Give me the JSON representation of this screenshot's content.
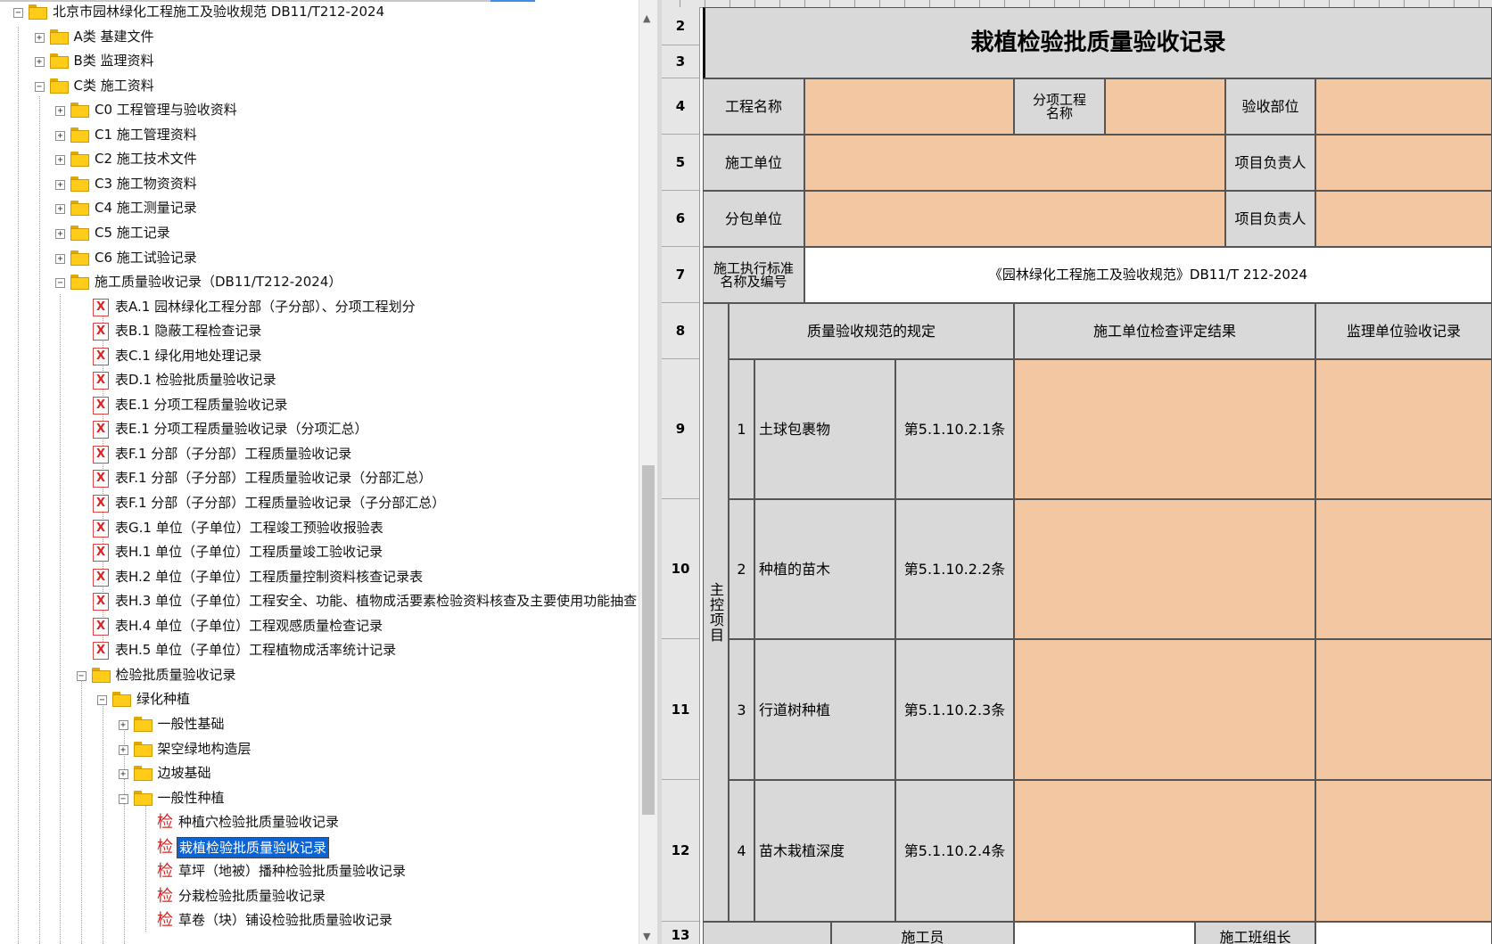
{
  "tree": {
    "root": "北京市园林绿化工程施工及验收规范 DB11/T212-2024",
    "nodes": [
      {
        "label": "A类 基建文件"
      },
      {
        "label": "B类 监理资料"
      },
      {
        "label": "C类 施工资料"
      },
      {
        "label": "C0 工程管理与验收资料"
      },
      {
        "label": "C1 施工管理资料"
      },
      {
        "label": "C2 施工技术文件"
      },
      {
        "label": "C3 施工物资资料"
      },
      {
        "label": "C4 施工测量记录"
      },
      {
        "label": "C5 施工记录"
      },
      {
        "label": "C6 施工试验记录"
      },
      {
        "label": "施工质量验收记录（DB11/T212-2024）"
      },
      {
        "label": "表A.1 园林绿化工程分部（子分部）、分项工程划分"
      },
      {
        "label": "表B.1 隐蔽工程检查记录"
      },
      {
        "label": "表C.1 绿化用地处理记录"
      },
      {
        "label": "表D.1 检验批质量验收记录"
      },
      {
        "label": "表E.1 分项工程质量验收记录"
      },
      {
        "label": "表E.1 分项工程质量验收记录（分项汇总）"
      },
      {
        "label": "表F.1 分部（子分部）工程质量验收记录"
      },
      {
        "label": "表F.1 分部（子分部）工程质量验收记录（分部汇总）"
      },
      {
        "label": "表F.1 分部（子分部）工程质量验收记录（子分部汇总）"
      },
      {
        "label": "表G.1 单位（子单位）工程竣工预验收报验表"
      },
      {
        "label": "表H.1 单位（子单位）工程质量竣工验收记录"
      },
      {
        "label": "表H.2 单位（子单位）工程质量控制资料核查记录表"
      },
      {
        "label": "表H.3 单位（子单位）工程安全、功能、植物成活要素检验资料核查及主要使用功能抽查"
      },
      {
        "label": "表H.4 单位（子单位）工程观感质量检查记录"
      },
      {
        "label": "表H.5 单位（子单位）工程植物成活率统计记录"
      },
      {
        "label": "检验批质量验收记录"
      },
      {
        "label": "绿化种植"
      },
      {
        "label": "一般性基础"
      },
      {
        "label": "架空绿地构造层"
      },
      {
        "label": "边坡基础"
      },
      {
        "label": "一般性种植"
      },
      {
        "label": "种植穴检验批质量验收记录"
      },
      {
        "label": "栽植检验批质量验收记录"
      },
      {
        "label": "草坪（地被）播种检验批质量验收记录"
      },
      {
        "label": "分栽检验批质量验收记录"
      },
      {
        "label": "草卷（块）铺设检验批质量验收记录"
      }
    ],
    "record_icon_glyph": "检",
    "excel_icon_glyph": "X",
    "expand_glyph": "+",
    "collapse_glyph": "−"
  },
  "sheet": {
    "row_numbers": [
      "2",
      "3",
      "4",
      "5",
      "6",
      "7",
      "8",
      "9",
      "10",
      "11",
      "12",
      "13"
    ],
    "title": "栽植检验批质量验收记录",
    "labels": {
      "project_name": "工程名称",
      "sub_project_name": "分项工程名称",
      "inspection_part": "验收部位",
      "construction_unit": "施工单位",
      "project_manager": "项目负责人",
      "subcontract_unit": "分包单位",
      "subcontract_manager": "项目负责人",
      "standard_name": "施工执行标准名称及编号",
      "standard_value": "《园林绿化工程施工及验收规范》DB11/T 212-2024",
      "spec_header": "质量验收规范的规定",
      "construction_result": "施工单位检查评定结果",
      "supervision_record": "监理单位验收记录",
      "main_control": "主控项目",
      "constructor": "施工员",
      "team_leader": "施工班组长"
    },
    "items": [
      {
        "no": "1",
        "name": "土球包裹物",
        "clause": "第5.1.10.2.1条"
      },
      {
        "no": "2",
        "name": "种植的苗木",
        "clause": "第5.1.10.2.2条"
      },
      {
        "no": "3",
        "name": "行道树种植",
        "clause": "第5.1.10.2.3条"
      },
      {
        "no": "4",
        "name": "苗木栽植深度",
        "clause": "第5.1.10.2.4条"
      }
    ],
    "colors": {
      "header_gray": "#d9d9d9",
      "input_orange": "#f2c7a1",
      "selection_blue": "#0a64d6"
    }
  }
}
